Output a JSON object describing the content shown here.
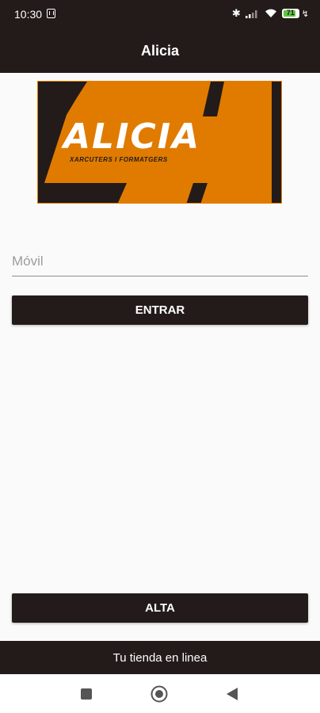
{
  "status_bar": {
    "time": "10:30",
    "battery_level": "71"
  },
  "app_bar": {
    "title": "Alicia"
  },
  "logo": {
    "name": "ALICIA",
    "tagline": "XARCUTERS I FORMATGERS",
    "colors": {
      "orange": "#e07b00",
      "dark": "#231b1a",
      "text": "#ffffff"
    }
  },
  "login": {
    "phone_placeholder": "Móvil",
    "phone_value": "",
    "enter_label": "ENTRAR"
  },
  "signup": {
    "label": "ALTA"
  },
  "footer": {
    "text": "Tu tienda en linea"
  },
  "nav": {
    "icons": [
      "recents-icon",
      "home-icon",
      "back-icon"
    ]
  },
  "theme": {
    "primary": "#231b1a",
    "background": "#fafafa",
    "accent": "#e07b00"
  }
}
